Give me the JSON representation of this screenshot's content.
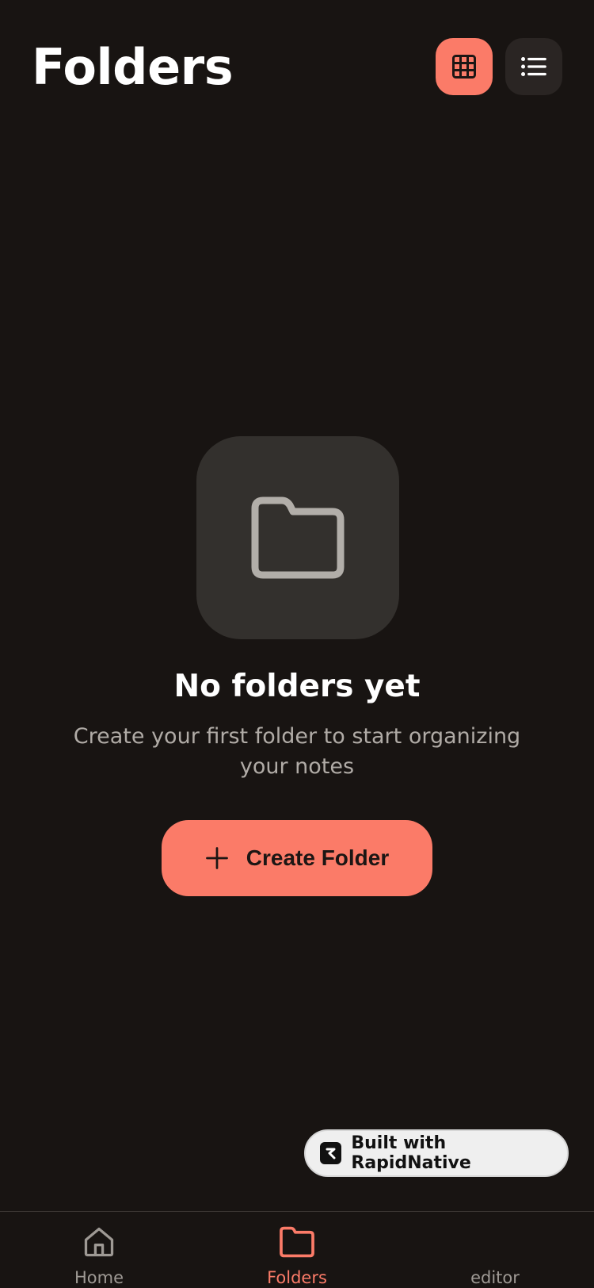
{
  "header": {
    "title": "Folders",
    "grid_view_icon": "grid-icon",
    "list_view_icon": "list-icon"
  },
  "empty_state": {
    "icon": "folder-icon",
    "title": "No folders yet",
    "subtitle": "Create your first folder to start organizing your notes",
    "create_button_label": "Create Folder",
    "create_button_icon": "plus-icon"
  },
  "badge": {
    "label": "Built with RapidNative",
    "icon": "rapidnative-logo-icon"
  },
  "tabbar": {
    "items": [
      {
        "label": "Home",
        "icon": "home-icon",
        "active": false
      },
      {
        "label": "Folders",
        "icon": "folder-icon",
        "active": true
      },
      {
        "label": "editor",
        "icon": "",
        "active": false
      }
    ]
  },
  "colors": {
    "background": "#181412",
    "accent": "#fb7b68",
    "card": "#33302d",
    "muted_text": "#b0aba6"
  }
}
